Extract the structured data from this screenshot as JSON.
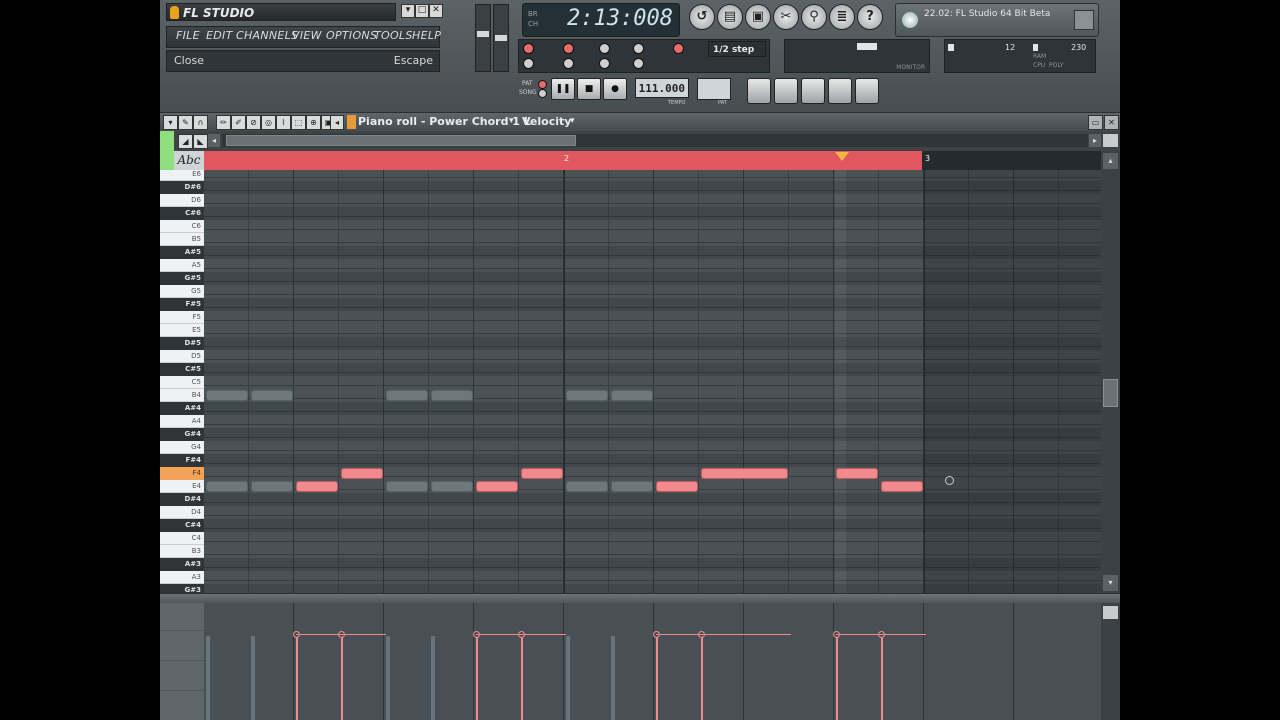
{
  "app": {
    "logo_text": "FL STUDIO",
    "window_buttons": [
      "▾",
      "□",
      "✕"
    ]
  },
  "menu": {
    "items": [
      "FILE",
      "EDIT",
      "CHANNELS",
      "VIEW",
      "OPTIONS",
      "TOOLS",
      "HELP"
    ]
  },
  "hint_bar": {
    "action": "Close",
    "shortcut": "Escape"
  },
  "transport": {
    "song_time": "2:13:008",
    "time_mode_top": "BR",
    "time_mode_bottom": "CH",
    "pat_label": "PAT",
    "song_label": "SONG",
    "tempo": "111.000",
    "tempo_label": "TEMPO",
    "pattern_label": "PAT",
    "step": "1/2 step",
    "cpu_value": "12",
    "poly_value": "230",
    "cpu_label": "CPU",
    "poly_label": "POLY",
    "ram_label": "RAM",
    "monitor_label": "MONITOR"
  },
  "news_panel": {
    "text": "22.02: FL Studio 64 Bit Beta"
  },
  "piano_roll": {
    "title": "Piano roll - Power Chord 1 L",
    "view_mode": "Velocity",
    "keyboard_mode": "Abc",
    "bar_markers": [
      "2",
      "3"
    ],
    "active_key": "F4",
    "keys": [
      {
        "name": "E6",
        "black": false
      },
      {
        "name": "D#6",
        "black": true
      },
      {
        "name": "D6",
        "black": false
      },
      {
        "name": "C#6",
        "black": true
      },
      {
        "name": "C6",
        "black": false
      },
      {
        "name": "B5",
        "black": false
      },
      {
        "name": "A#5",
        "black": true
      },
      {
        "name": "A5",
        "black": false
      },
      {
        "name": "G#5",
        "black": true
      },
      {
        "name": "G5",
        "black": false
      },
      {
        "name": "F#5",
        "black": true
      },
      {
        "name": "F5",
        "black": false
      },
      {
        "name": "E5",
        "black": false
      },
      {
        "name": "D#5",
        "black": true
      },
      {
        "name": "D5",
        "black": false
      },
      {
        "name": "C#5",
        "black": true
      },
      {
        "name": "C5",
        "black": false
      },
      {
        "name": "B4",
        "black": false
      },
      {
        "name": "A#4",
        "black": true
      },
      {
        "name": "A4",
        "black": false
      },
      {
        "name": "G#4",
        "black": true
      },
      {
        "name": "G4",
        "black": false
      },
      {
        "name": "F#4",
        "black": true
      },
      {
        "name": "F4",
        "black": false
      },
      {
        "name": "E4",
        "black": false
      },
      {
        "name": "D#4",
        "black": true
      },
      {
        "name": "D4",
        "black": false
      },
      {
        "name": "C#4",
        "black": true
      },
      {
        "name": "C4",
        "black": false
      },
      {
        "name": "B3",
        "black": false
      },
      {
        "name": "A#3",
        "black": true
      },
      {
        "name": "A3",
        "black": false
      },
      {
        "name": "G#3",
        "black": true
      }
    ],
    "notes": [
      {
        "pitch": "B4",
        "start": 0.0,
        "length": 0.5,
        "ghost": true
      },
      {
        "pitch": "B4",
        "start": 0.5,
        "length": 0.5,
        "ghost": true
      },
      {
        "pitch": "B4",
        "start": 2.0,
        "length": 0.5,
        "ghost": true
      },
      {
        "pitch": "B4",
        "start": 2.5,
        "length": 0.5,
        "ghost": true
      },
      {
        "pitch": "B4",
        "start": 4.0,
        "length": 0.5,
        "ghost": true
      },
      {
        "pitch": "B4",
        "start": 4.5,
        "length": 0.5,
        "ghost": true
      },
      {
        "pitch": "E4",
        "start": 0.0,
        "length": 0.5,
        "ghost": true
      },
      {
        "pitch": "E4",
        "start": 0.5,
        "length": 0.5,
        "ghost": true
      },
      {
        "pitch": "E4",
        "start": 1.0,
        "length": 0.5,
        "ghost": false
      },
      {
        "pitch": "F4",
        "start": 1.5,
        "length": 0.5,
        "ghost": false
      },
      {
        "pitch": "E4",
        "start": 2.0,
        "length": 0.5,
        "ghost": true
      },
      {
        "pitch": "E4",
        "start": 2.5,
        "length": 0.5,
        "ghost": true
      },
      {
        "pitch": "E4",
        "start": 3.0,
        "length": 0.5,
        "ghost": false
      },
      {
        "pitch": "F4",
        "start": 3.5,
        "length": 0.5,
        "ghost": false
      },
      {
        "pitch": "E4",
        "start": 4.0,
        "length": 0.5,
        "ghost": true
      },
      {
        "pitch": "E4",
        "start": 4.5,
        "length": 0.5,
        "ghost": true
      },
      {
        "pitch": "E4",
        "start": 5.0,
        "length": 0.5,
        "ghost": false
      },
      {
        "pitch": "F4",
        "start": 5.5,
        "length": 1.0,
        "ghost": false
      },
      {
        "pitch": "F4",
        "start": 7.0,
        "length": 0.5,
        "ghost": false
      },
      {
        "pitch": "E4",
        "start": 7.5,
        "length": 0.5,
        "ghost": false
      }
    ],
    "velocities": [
      {
        "start": 0.0,
        "ghost": true
      },
      {
        "start": 0.5,
        "ghost": true
      },
      {
        "start": 1.0,
        "ghost": false
      },
      {
        "start": 1.5,
        "ghost": false
      },
      {
        "start": 2.0,
        "ghost": true
      },
      {
        "start": 2.5,
        "ghost": true
      },
      {
        "start": 3.0,
        "ghost": false
      },
      {
        "start": 3.5,
        "ghost": false
      },
      {
        "start": 4.0,
        "ghost": true
      },
      {
        "start": 4.5,
        "ghost": true
      },
      {
        "start": 5.0,
        "ghost": false
      },
      {
        "start": 5.5,
        "ghost": false
      },
      {
        "start": 7.0,
        "ghost": false
      },
      {
        "start": 7.5,
        "ghost": false
      }
    ],
    "note_velocity": 0.78
  },
  "colors": {
    "loop_range": "#e0575f",
    "note": "#f08a8d",
    "ghost_note": "#6d777c",
    "active_key": "#f2a35a"
  }
}
